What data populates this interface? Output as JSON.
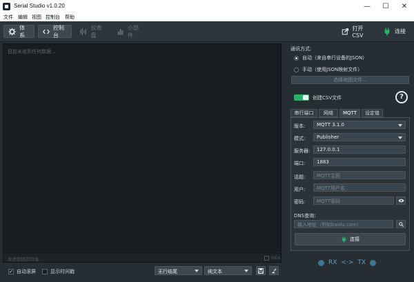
{
  "window": {
    "title": "Serial Studio v1.0.20",
    "minimize": "—",
    "maximize": "☐",
    "close": "✕"
  },
  "menu": [
    "文件",
    "编辑",
    "视图",
    "控制台",
    "帮助"
  ],
  "toolbar": {
    "setup": "体系",
    "console": "控制台",
    "dashboard": "仪表盘",
    "widgets": "小部件",
    "open_csv": "打开CSV",
    "connect": "连接"
  },
  "console": {
    "placeholder": "目前未收到任何数据...",
    "send_placeholder": "发送数据到设备...",
    "hex_label": "HEX",
    "autoscroll": "自动滚屏",
    "autoscroll_checked": true,
    "timestamp": "显示时间戳",
    "timestamp_checked": false,
    "line_ending": "无行结尾",
    "display_mode": "纯文本",
    "save_icon": "save-icon",
    "clear_icon": "clear-icon"
  },
  "panel": {
    "comm_mode_label": "通讯方式:",
    "auto_option": "自动（来自串行设备的JSON）",
    "manual_option": "手动（使用JSON映射文件）",
    "select_map": "选择地图文件...",
    "create_csv": "创建CSV文件",
    "help_icon": "help-icon",
    "tabs": [
      "串行端口",
      "网络",
      "MQTT",
      "设定值"
    ],
    "active_tab": 2,
    "form": {
      "version_label": "版本:",
      "version_value": "MQTT 3.1.0",
      "mode_label": "模式:",
      "mode_value": "Publisher",
      "host_label": "服务器:",
      "host_value": "127.0.0.1",
      "port_label": "端口:",
      "port_value": "1883",
      "topic_label": "话题:",
      "topic_placeholder": "MQTT主题",
      "user_label": "用户:",
      "user_placeholder": "MQTT用户名",
      "password_label": "密码:",
      "password_placeholder": "MQTT密码",
      "dns_label": "DNS查询:",
      "dns_placeholder": "输入地址（例如baidu.com）",
      "connect": "连接"
    },
    "rx": "RX",
    "arrows": "<·>",
    "tx": "TX"
  },
  "colors": {
    "accent_green": "#28b36a",
    "led_blue": "#3e7591",
    "background": "#262d33"
  }
}
